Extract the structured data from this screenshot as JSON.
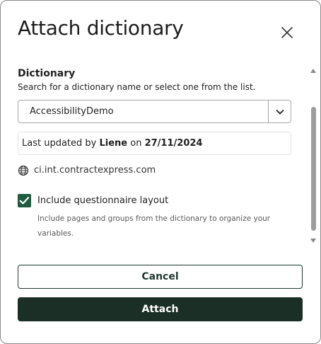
{
  "dialog": {
    "title": "Attach dictionary",
    "close_icon": "close-icon"
  },
  "dictionary": {
    "section_title": "Dictionary",
    "helper_text": "Search for a dictionary name or select one from the list.",
    "selected_value": "AccessibilityDemo",
    "dropdown_icon": "chevron-down-icon"
  },
  "last_updated": {
    "prefix": "Last updated by ",
    "user": "Liene",
    "mid": " on ",
    "date": "27/11/2024"
  },
  "host": {
    "icon": "globe-icon",
    "text": "ci.int.contractexpress.com"
  },
  "include_layout": {
    "checked": true,
    "label": "Include questionnaire layout",
    "description": "Include pages and groups from the dictionary to organize your variables."
  },
  "buttons": {
    "cancel_label": "Cancel",
    "attach_label": "Attach"
  },
  "colors": {
    "accent": "#1e5b40",
    "primary_button": "#1b2f27",
    "scrollbar": "#9d9d9d"
  }
}
